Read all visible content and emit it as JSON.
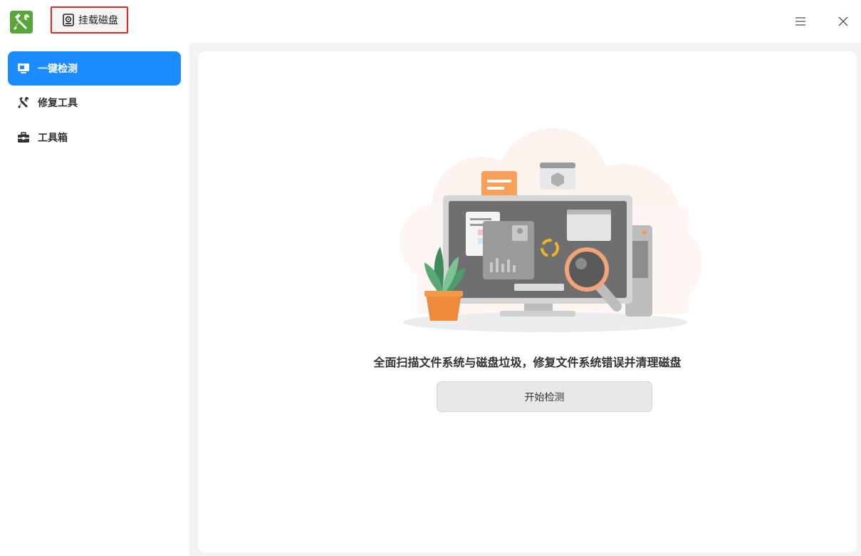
{
  "titlebar": {
    "mount_button_label": "挂载磁盘"
  },
  "sidebar": {
    "items": [
      {
        "label": "一键检测",
        "icon": "monitor-icon",
        "active": true
      },
      {
        "label": "修复工具",
        "icon": "tools-icon",
        "active": false
      },
      {
        "label": "工具箱",
        "icon": "toolbox-icon",
        "active": false
      }
    ]
  },
  "main": {
    "description": "全面扫描文件系统与磁盘垃圾，修复文件系统错误并清理磁盘",
    "start_button_label": "开始检测"
  },
  "colors": {
    "accent": "#1a8cff",
    "highlight_border": "#e0272a",
    "app_icon": "#5aa53a"
  }
}
